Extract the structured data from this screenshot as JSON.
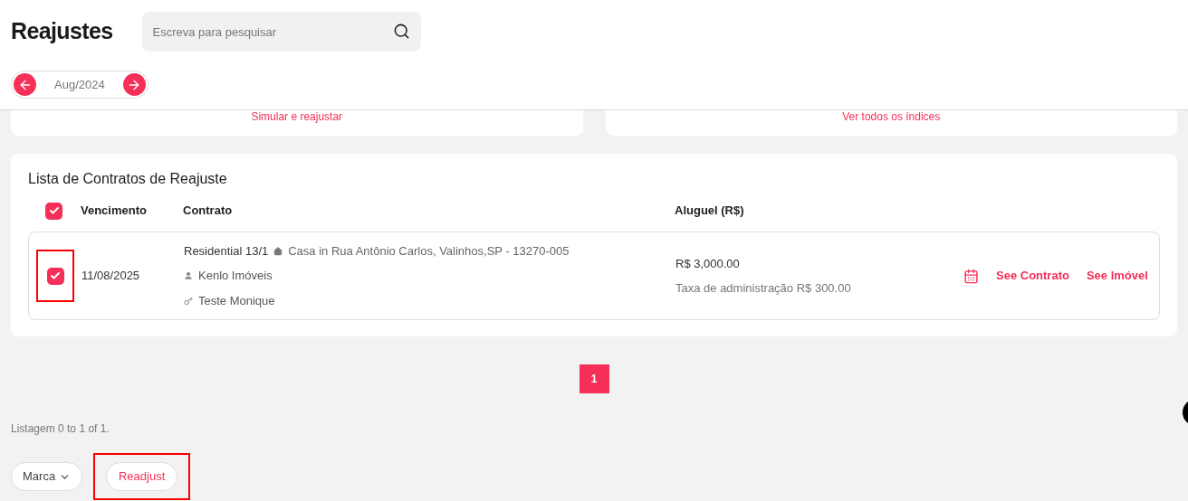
{
  "page_title": "Reajustes",
  "search": {
    "placeholder": "Escreva para pesquisar"
  },
  "month_nav": {
    "label": "Aug/2024"
  },
  "summary_cards": [
    {
      "link": "Simular e reajustar"
    },
    {
      "link": "Ver todos os índices"
    }
  ],
  "list": {
    "title": "Lista de Contratos de Reajuste",
    "select_all_checked": true,
    "columns": [
      "Vencimento",
      "Contrato",
      "Aluguel (R$)"
    ],
    "rows": [
      {
        "checked": true,
        "highlighted": true,
        "due": "11/08/2025",
        "contract": "Residential 13/1",
        "address": "Casa in Rua Antônio Carlos, Valinhos,SP - 13270-005",
        "owner": "Kenlo Imóveis",
        "tenant": "Teste Monique",
        "rent": "R$ 3,000.00",
        "fee": "Taxa de administração R$ 300.00",
        "actions": [
          "See Contrato",
          "See Imóvel"
        ]
      }
    ]
  },
  "pagination": [
    {
      "label": "1",
      "selected": true
    }
  ],
  "listing_info": "Listagem 0 to 1 of 1.",
  "footer_buttons": [
    {
      "label": "Marca",
      "kind": "dropdown",
      "highlighted": false
    },
    {
      "label": "Readjust",
      "kind": "action",
      "highlighted": true
    }
  ]
}
